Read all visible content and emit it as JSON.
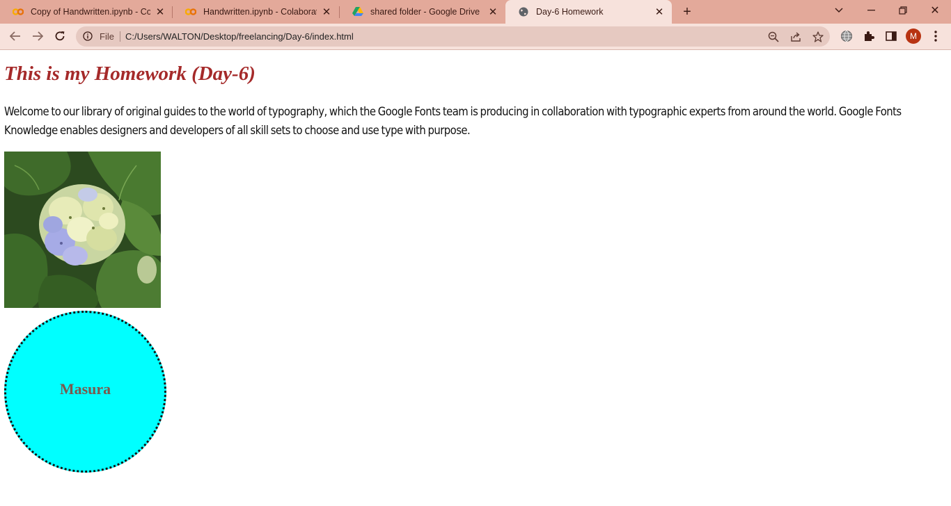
{
  "browser": {
    "tabs": [
      {
        "title": "Copy of Handwritten.ipynb - Colaboratory",
        "favicon": "colab-icon"
      },
      {
        "title": "Handwritten.ipynb - Colaboratory",
        "favicon": "colab-icon"
      },
      {
        "title": "shared folder - Google Drive",
        "favicon": "google-drive-icon"
      },
      {
        "title": "Day-6 Homework",
        "favicon": "globe-icon",
        "active": true
      }
    ],
    "address": {
      "scheme_label": "File",
      "url": "C:/Users/WALTON/Desktop/freelancing/Day-6/index.html"
    },
    "profile_initial": "M",
    "colors": {
      "tabstrip": "#e3a99a",
      "toolbar": "#f7e2dc",
      "avatar": "#b83312"
    }
  },
  "page": {
    "heading": "This is my Homework (Day-6)",
    "paragraph": "Welcome to our library of original guides to the world of typography, which the Google Fonts team is producing in collaboration with typographic experts from around the world. Google Fonts Knowledge enables designers and developers of all skill sets to choose and use type with purpose.",
    "image": {
      "description_icon": "hydrangea-photo"
    },
    "circle_label": "Masura",
    "colors": {
      "heading": "#a52a2a",
      "circle_fill": "#00ffff"
    }
  }
}
